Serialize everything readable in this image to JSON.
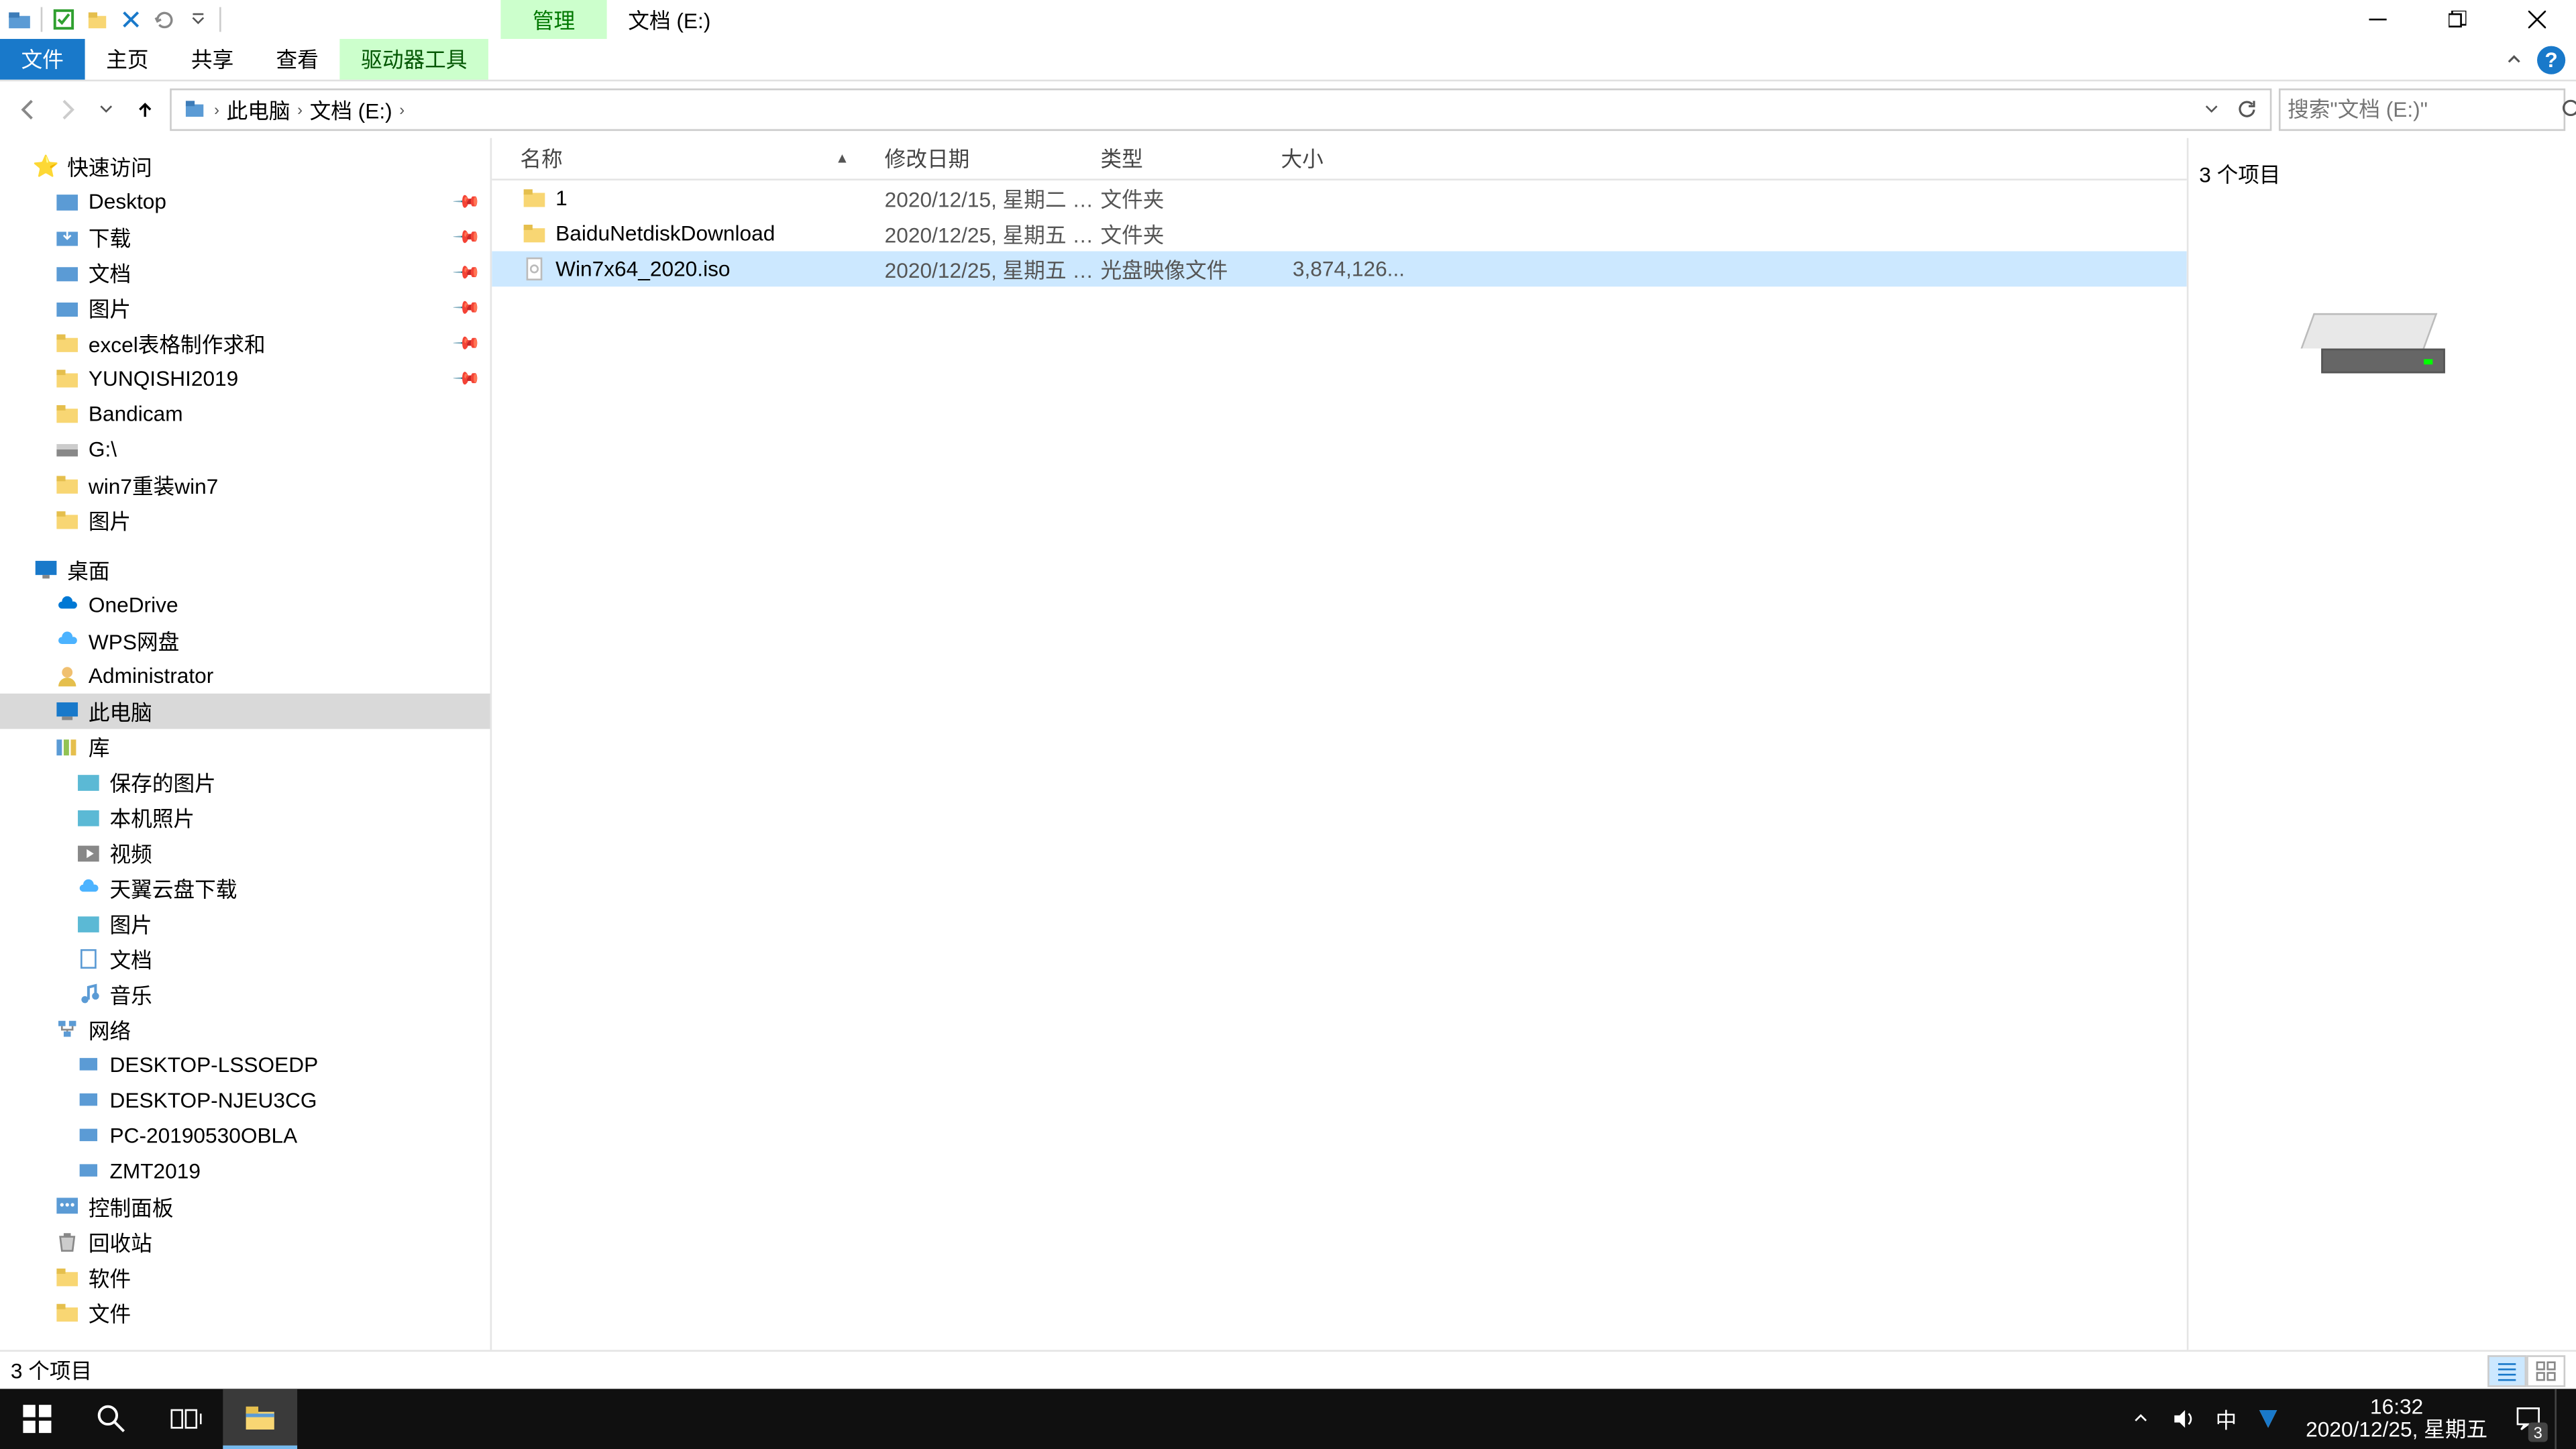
{
  "titlebar": {
    "ctx_tab": "管理",
    "title": "文档 (E:)"
  },
  "ribbon": {
    "file": "文件",
    "home": "主页",
    "share": "共享",
    "view": "查看",
    "ctx": "驱动器工具"
  },
  "addr": {
    "computer": "此电脑",
    "drive": "文档 (E:)"
  },
  "search": {
    "placeholder": "搜索\"文档 (E:)\""
  },
  "tree": {
    "quick": "快速访问",
    "desktop": "Desktop",
    "downloads": "下载",
    "documents": "文档",
    "pictures": "图片",
    "excel": "excel表格制作求和",
    "yunqishi": "YUNQISHI2019",
    "bandicam": "Bandicam",
    "gdrive": "G:\\",
    "win7": "win7重装win7",
    "pictures2": "图片",
    "zdesktop": "桌面",
    "onedrive": "OneDrive",
    "wps": "WPS网盘",
    "admin": "Administrator",
    "thispc": "此电脑",
    "library": "库",
    "savedpics": "保存的图片",
    "localpics": "本机照片",
    "video": "视频",
    "tycloud": "天翼云盘下载",
    "pics3": "图片",
    "docs3": "文档",
    "music": "音乐",
    "network": "网络",
    "pc1": "DESKTOP-LSSOEDP",
    "pc2": "DESKTOP-NJEU3CG",
    "pc3": "PC-20190530OBLA",
    "pc4": "ZMT2019",
    "ctrlpanel": "控制面板",
    "recycle": "回收站",
    "soft": "软件",
    "files": "文件"
  },
  "cols": {
    "name": "名称",
    "date": "修改日期",
    "type": "类型",
    "size": "大小"
  },
  "files": [
    {
      "name": "1",
      "date": "2020/12/15, 星期二 1...",
      "type": "文件夹",
      "size": "",
      "icon": "folder"
    },
    {
      "name": "BaiduNetdiskDownload",
      "date": "2020/12/25, 星期五 1...",
      "type": "文件夹",
      "size": "",
      "icon": "folder"
    },
    {
      "name": "Win7x64_2020.iso",
      "date": "2020/12/25, 星期五 1...",
      "type": "光盘映像文件",
      "size": "3,874,126...",
      "icon": "file"
    }
  ],
  "preview": {
    "title": "3 个项目"
  },
  "status": {
    "text": "3 个项目"
  },
  "taskbar": {
    "time": "16:32",
    "date": "2020/12/25, 星期五",
    "ime": "中",
    "notif_count": "3"
  }
}
